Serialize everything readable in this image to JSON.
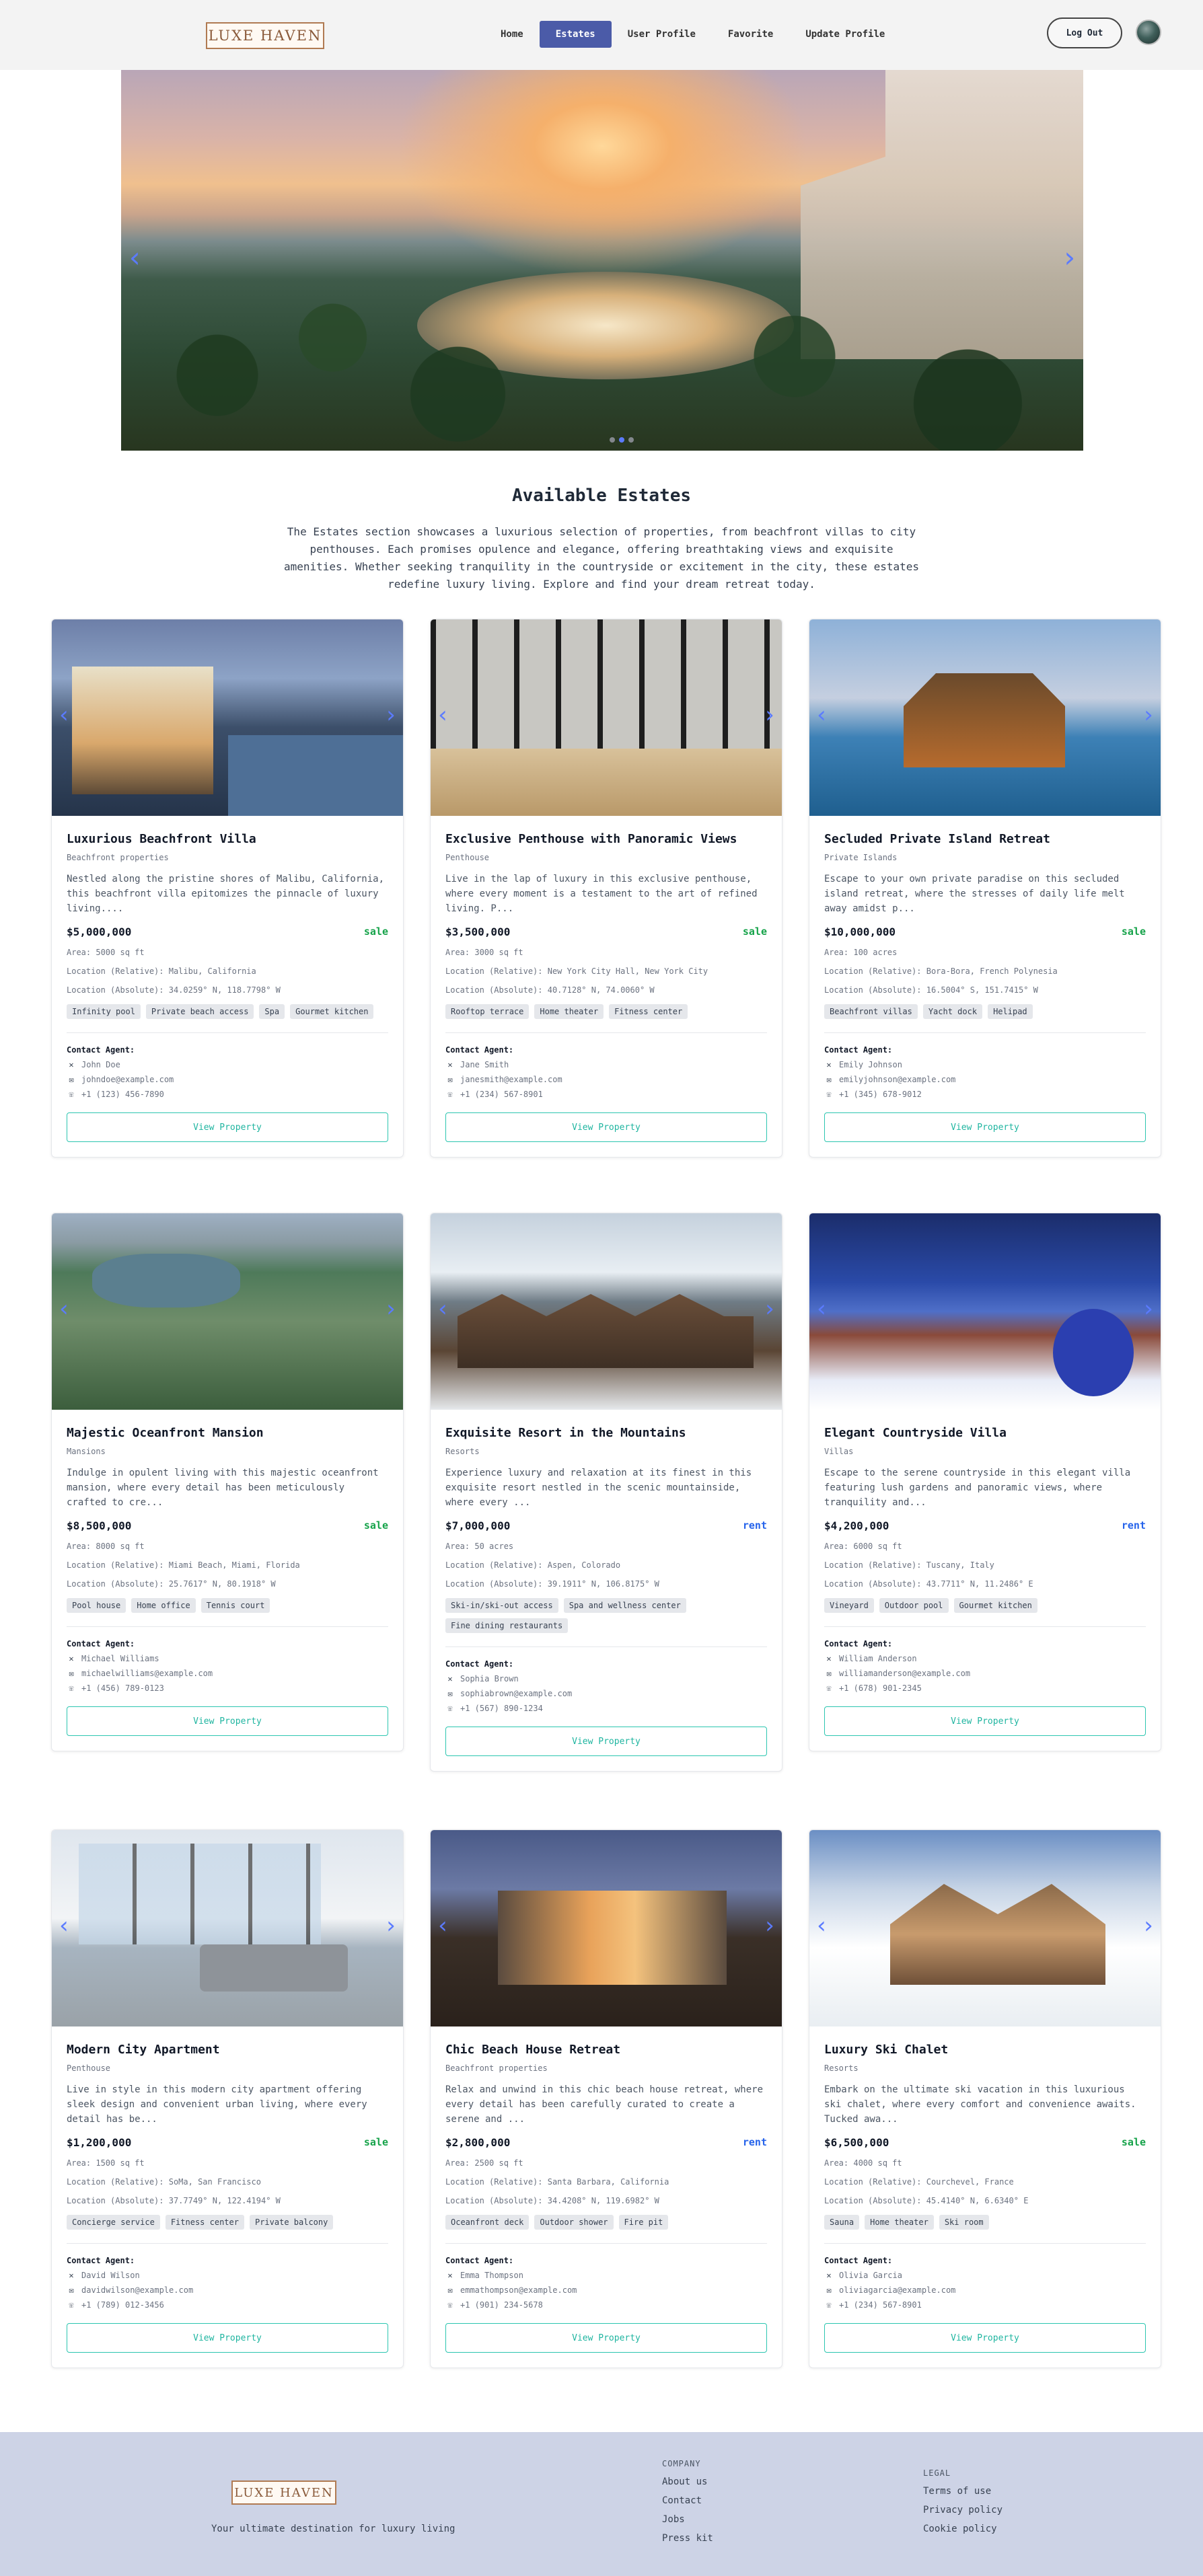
{
  "nav": {
    "logo": "LUXE HAVEN",
    "links": [
      "Home",
      "Estates",
      "User Profile",
      "Favorite",
      "Update Profile"
    ],
    "active": "Estates",
    "logout": "Log Out"
  },
  "hero": {
    "prev": "‹",
    "next": "›"
  },
  "section": {
    "title": "Available Estates",
    "description": "The Estates section showcases a luxurious selection of properties, from beachfront villas to city penthouses. Each promises opulence and elegance, offering breathtaking views and exquisite amenities. Whether seeking tranquility in the countryside or excitement in the city, these estates redefine luxury living. Explore and find your dream retreat today."
  },
  "labels": {
    "contact_agent": "Contact Agent:",
    "view_property": "View Property"
  },
  "properties": [
    {
      "title": "Luxurious Beachfront Villa",
      "type": "Beachfront properties",
      "description": "Nestled along the pristine shores of Malibu, California, this beachfront villa epitomizes the pinnacle of luxury living....",
      "price": "$5,000,000",
      "status": "sale",
      "area": "Area: 5000 sq ft",
      "location_relative": "Location (Relative): Malibu, California",
      "location_absolute": "Location (Absolute): 34.0259° N, 118.7798° W",
      "amenities": [
        "Infinity pool",
        "Private beach access",
        "Spa",
        "Gourmet kitchen"
      ],
      "agent": {
        "name": "John Doe",
        "email": "johndoe@example.com",
        "phone": "+1 (123) 456-7890"
      }
    },
    {
      "title": "Exclusive Penthouse with Panoramic Views",
      "type": "Penthouse",
      "description": "Live in the lap of luxury in this exclusive penthouse, where every moment is a testament to the art of refined living. P...",
      "price": "$3,500,000",
      "status": "sale",
      "area": "Area: 3000 sq ft",
      "location_relative": "Location (Relative): New York City Hall, New York City",
      "location_absolute": "Location (Absolute): 40.7128° N, 74.0060° W",
      "amenities": [
        "Rooftop terrace",
        "Home theater",
        "Fitness center"
      ],
      "agent": {
        "name": "Jane Smith",
        "email": "janesmith@example.com",
        "phone": "+1 (234) 567-8901"
      }
    },
    {
      "title": "Secluded Private Island Retreat",
      "type": "Private Islands",
      "description": "Escape to your own private paradise on this secluded island retreat, where the stresses of daily life melt away amidst p...",
      "price": "$10,000,000",
      "status": "sale",
      "area": "Area: 100 acres",
      "location_relative": "Location (Relative): Bora-Bora, French Polynesia",
      "location_absolute": "Location (Absolute): 16.5004° S, 151.7415° W",
      "amenities": [
        "Beachfront villas",
        "Yacht dock",
        "Helipad"
      ],
      "agent": {
        "name": "Emily Johnson",
        "email": "emilyjohnson@example.com",
        "phone": "+1 (345) 678-9012"
      }
    },
    {
      "title": "Majestic Oceanfront Mansion",
      "type": "Mansions",
      "description": "Indulge in opulent living with this majestic oceanfront mansion, where every detail has been meticulously crafted to cre...",
      "price": "$8,500,000",
      "status": "sale",
      "area": "Area: 8000 sq ft",
      "location_relative": "Location (Relative): Miami Beach, Miami, Florida",
      "location_absolute": "Location (Absolute): 25.7617° N, 80.1918° W",
      "amenities": [
        "Pool house",
        "Home office",
        "Tennis court"
      ],
      "agent": {
        "name": "Michael Williams",
        "email": "michaelwilliams@example.com",
        "phone": "+1 (456) 789-0123"
      }
    },
    {
      "title": "Exquisite Resort in the Mountains",
      "type": "Resorts",
      "description": "Experience luxury and relaxation at its finest in this exquisite resort nestled in the scenic mountainside, where every ...",
      "price": "$7,000,000",
      "status": "rent",
      "area": "Area: 50 acres",
      "location_relative": "Location (Relative): Aspen, Colorado",
      "location_absolute": "Location (Absolute): 39.1911° N, 106.8175° W",
      "amenities": [
        "Ski-in/ski-out access",
        "Spa and wellness center",
        "Fine dining restaurants"
      ],
      "agent": {
        "name": "Sophia Brown",
        "email": "sophiabrown@example.com",
        "phone": "+1 (567) 890-1234"
      }
    },
    {
      "title": "Elegant Countryside Villa",
      "type": "Villas",
      "description": "Escape to the serene countryside in this elegant villa featuring lush gardens and panoramic views, where tranquility and...",
      "price": "$4,200,000",
      "status": "rent",
      "area": "Area: 6000 sq ft",
      "location_relative": "Location (Relative): Tuscany, Italy",
      "location_absolute": "Location (Absolute): 43.7711° N, 11.2486° E",
      "amenities": [
        "Vineyard",
        "Outdoor pool",
        "Gourmet kitchen"
      ],
      "agent": {
        "name": "William Anderson",
        "email": "williamanderson@example.com",
        "phone": "+1 (678) 901-2345"
      }
    },
    {
      "title": "Modern City Apartment",
      "type": "Penthouse",
      "description": "Live in style in this modern city apartment offering sleek design and convenient urban living, where every detail has be...",
      "price": "$1,200,000",
      "status": "sale",
      "area": "Area: 1500 sq ft",
      "location_relative": "Location (Relative): SoMa, San Francisco",
      "location_absolute": "Location (Absolute): 37.7749° N, 122.4194° W",
      "amenities": [
        "Concierge service",
        "Fitness center",
        "Private balcony"
      ],
      "agent": {
        "name": "David Wilson",
        "email": "davidwilson@example.com",
        "phone": "+1 (789) 012-3456"
      }
    },
    {
      "title": "Chic Beach House Retreat",
      "type": "Beachfront properties",
      "description": "Relax and unwind in this chic beach house retreat, where every detail has been carefully curated to create a serene and ...",
      "price": "$2,800,000",
      "status": "rent",
      "area": "Area: 2500 sq ft",
      "location_relative": "Location (Relative): Santa Barbara, California",
      "location_absolute": "Location (Absolute): 34.4208° N, 119.6982° W",
      "amenities": [
        "Oceanfront deck",
        "Outdoor shower",
        "Fire pit"
      ],
      "agent": {
        "name": "Emma Thompson",
        "email": "emmathompson@example.com",
        "phone": "+1 (901) 234-5678"
      }
    },
    {
      "title": "Luxury Ski Chalet",
      "type": "Resorts",
      "description": "Embark on the ultimate ski vacation in this luxurious ski chalet, where every comfort and convenience awaits. Tucked awa...",
      "price": "$6,500,000",
      "status": "sale",
      "area": "Area: 4000 sq ft",
      "location_relative": "Location (Relative): Courchevel, France",
      "location_absolute": "Location (Absolute): 45.4140° N, 6.6340° E",
      "amenities": [
        "Sauna",
        "Home theater",
        "Ski room"
      ],
      "agent": {
        "name": "Olivia Garcia",
        "email": "oliviagarcia@example.com",
        "phone": "+1 (234) 567-8901"
      }
    }
  ],
  "footer": {
    "logo": "LUXE HAVEN",
    "tagline": "Your ultimate destination for luxury living",
    "company_heading": "COMPANY",
    "company_links": [
      "About us",
      "Contact",
      "Jobs",
      "Press kit"
    ],
    "legal_heading": "LEGAL",
    "legal_links": [
      "Terms of use",
      "Privacy policy",
      "Cookie policy"
    ]
  }
}
